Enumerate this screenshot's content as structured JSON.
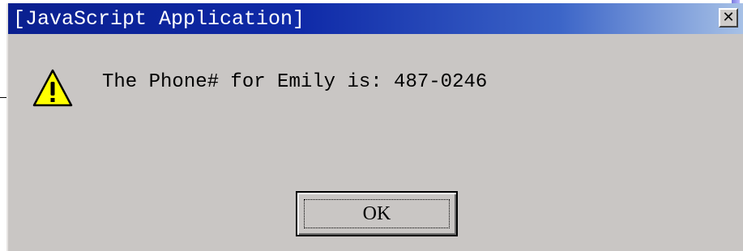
{
  "dialog": {
    "title": "[JavaScript Application]",
    "close_icon": "close-icon",
    "warning_icon": "warning-icon",
    "message": "The Phone# for Emily is: 487-0246",
    "ok_label": "OK"
  },
  "colors": {
    "titlebar_start": "#0a1f8f",
    "titlebar_end": "#a7c1e6",
    "dialog_bg": "#c9c6c4",
    "warning_fill": "#ffff00"
  }
}
